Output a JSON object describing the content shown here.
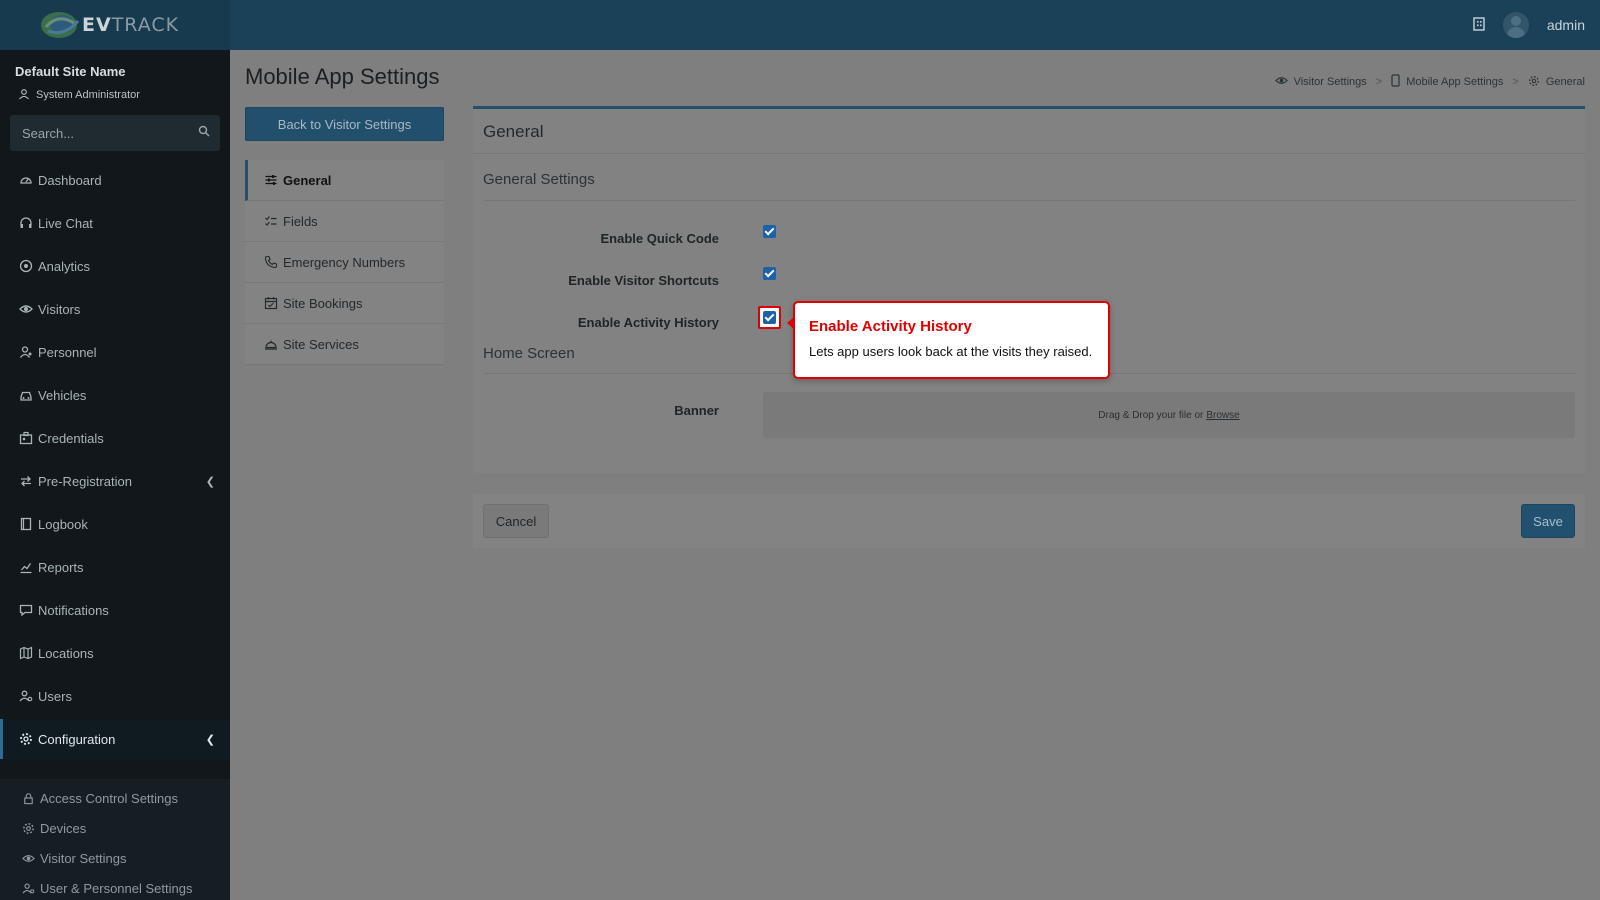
{
  "brand": {
    "logo_bold": "EV",
    "logo_rest": "TRACK"
  },
  "header": {
    "username": "admin"
  },
  "sidebar": {
    "site_name": "Default Site Name",
    "role": "System Administrator",
    "search_placeholder": "Search...",
    "items": [
      {
        "label": "Dashboard",
        "icon": "gauge-icon"
      },
      {
        "label": "Live Chat",
        "icon": "headset-icon"
      },
      {
        "label": "Analytics",
        "icon": "target-icon"
      },
      {
        "label": "Visitors",
        "icon": "eye-icon"
      },
      {
        "label": "Personnel",
        "icon": "user-icon"
      },
      {
        "label": "Vehicles",
        "icon": "car-icon"
      },
      {
        "label": "Credentials",
        "icon": "id-card-icon"
      },
      {
        "label": "Pre-Registration",
        "icon": "arrows-icon"
      },
      {
        "label": "Logbook",
        "icon": "book-icon"
      },
      {
        "label": "Reports",
        "icon": "chart-icon"
      },
      {
        "label": "Notifications",
        "icon": "chat-icon"
      },
      {
        "label": "Locations",
        "icon": "map-icon"
      },
      {
        "label": "Users",
        "icon": "users-icon"
      },
      {
        "label": "Configuration",
        "icon": "gear-icon"
      }
    ],
    "sub_items": [
      {
        "label": "Access Control Settings",
        "icon": "lock-icon"
      },
      {
        "label": "Devices",
        "icon": "cog-icon"
      },
      {
        "label": "Visitor Settings",
        "icon": "eye-icon"
      },
      {
        "label": "User & Personnel Settings",
        "icon": "user-gear-icon"
      }
    ]
  },
  "page": {
    "title": "Mobile App Settings",
    "back_button": "Back to Visitor Settings",
    "breadcrumb": [
      "Visitor Settings",
      "Mobile App Settings",
      "General"
    ]
  },
  "subnav": [
    {
      "label": "General",
      "icon": "sliders-icon"
    },
    {
      "label": "Fields",
      "icon": "checklist-icon"
    },
    {
      "label": "Emergency Numbers",
      "icon": "phone-icon"
    },
    {
      "label": "Site Bookings",
      "icon": "calendar-icon"
    },
    {
      "label": "Site Services",
      "icon": "bell-icon"
    }
  ],
  "card": {
    "title": "General",
    "general_settings": {
      "title": "General Settings",
      "fields": [
        {
          "label": "Enable Quick Code",
          "checked": true
        },
        {
          "label": "Enable Visitor Shortcuts",
          "checked": true
        },
        {
          "label": "Enable Activity History",
          "checked": true
        }
      ]
    },
    "home_screen": {
      "title": "Home Screen",
      "banner_label": "Banner",
      "drop_text": "Drag & Drop your file or",
      "browse_text": "Browse"
    }
  },
  "actions": {
    "cancel": "Cancel",
    "save": "Save"
  },
  "tooltip": {
    "title": "Enable Activity History",
    "body": "Lets app users look back at the visits they raised."
  },
  "colors": {
    "accent": "#25506c",
    "highlight": "#e00000",
    "checkbox": "#1c62a8"
  }
}
